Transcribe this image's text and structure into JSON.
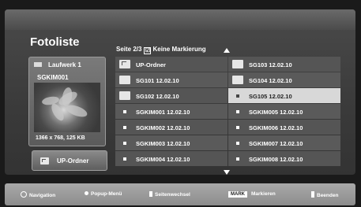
{
  "header": {
    "title": "Fotoliste"
  },
  "page_info": {
    "page": "Seite 2/3",
    "mark_status": "Keine Markierung",
    "checkbox_glyph": "☑"
  },
  "left_panel": {
    "drive": "Laufwerk 1",
    "selected_file": "SGKIM001",
    "resolution": "1366 x 768, 125 KB",
    "up_button": "UP-Ordner"
  },
  "items": [
    {
      "label": "UP-Ordner",
      "icon": "folder-up-icon",
      "selected": false
    },
    {
      "label": "SG103 12.02.10",
      "icon": "folder-icon",
      "selected": false
    },
    {
      "label": "SG101 12.02.10",
      "icon": "folder-icon",
      "selected": false
    },
    {
      "label": "SG104 12.02.10",
      "icon": "folder-icon",
      "selected": false
    },
    {
      "label": "SG102 12.02.10",
      "icon": "folder-icon",
      "selected": false
    },
    {
      "label": "SG105 12.02.10",
      "icon": "photo-bullet-icon",
      "selected": true
    },
    {
      "label": "SGKIM001 12.02.10",
      "icon": "photo-bullet-icon",
      "selected": false
    },
    {
      "label": "SGKIM005 12.02.10",
      "icon": "photo-bullet-icon",
      "selected": false
    },
    {
      "label": "SGKIM002 12.02.10",
      "icon": "photo-bullet-icon",
      "selected": false
    },
    {
      "label": "SGKIM006 12.02.10",
      "icon": "photo-bullet-icon",
      "selected": false
    },
    {
      "label": "SGKIM003 12.02.10",
      "icon": "photo-bullet-icon",
      "selected": false
    },
    {
      "label": "SGKIM007 12.02.10",
      "icon": "photo-bullet-icon",
      "selected": false
    },
    {
      "label": "SGKIM004 12.02.10",
      "icon": "photo-bullet-icon",
      "selected": false
    },
    {
      "label": "SGKIM008 12.02.10",
      "icon": "photo-bullet-icon",
      "selected": false
    }
  ],
  "footer": {
    "navigation": "Navigation",
    "popup_menu": "Popup-Menü",
    "page_change": "Seitenwechsel",
    "mark_key": "MARK",
    "mark": "Markieren",
    "exit": "Beenden"
  },
  "colors": {
    "background": "#1a1a1a",
    "panel": "#3a3a3a",
    "selected": "#d8d8d8",
    "footer": "#9a9a9a"
  }
}
